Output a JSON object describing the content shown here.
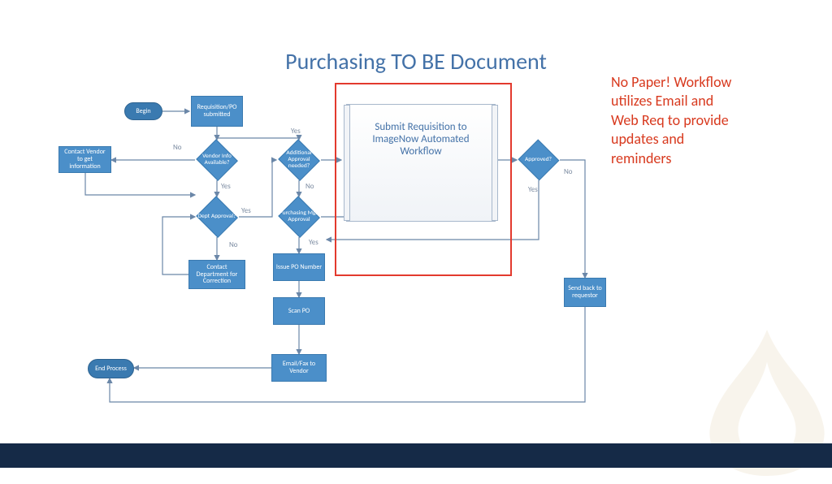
{
  "title": "Purchasing TO BE Document",
  "annotation": "No Paper! Workflow utilizes Email and Web Req to provide updates and reminders",
  "workflow_card": "Submit Requisition to ImageNow Automated Workflow",
  "nodes": {
    "begin": "Begin",
    "req_submitted": "Requisition/PO submitted",
    "vendor_info": "Vendor Info Available?",
    "contact_vendor": "Contact Vendor to get information",
    "dept_approval": "Dept Approval?",
    "contact_dept": "Contact Department for Correction",
    "additional_approval": "Additional Approval needed?",
    "purchasing_mgr": "Purchasing Mgr. Approval",
    "issue_po": "Issue PO Number",
    "scan_po": "Scan PO",
    "email_fax": "Email/Fax to Vendor",
    "approved": "Approved?",
    "send_back": "Send back to requestor",
    "end_process": "End Process"
  },
  "labels": {
    "yes": "Yes",
    "no": "No"
  },
  "colors": {
    "accent": "#4472a8",
    "annotation": "#d83a1f",
    "highlight": "#e33a2e"
  }
}
